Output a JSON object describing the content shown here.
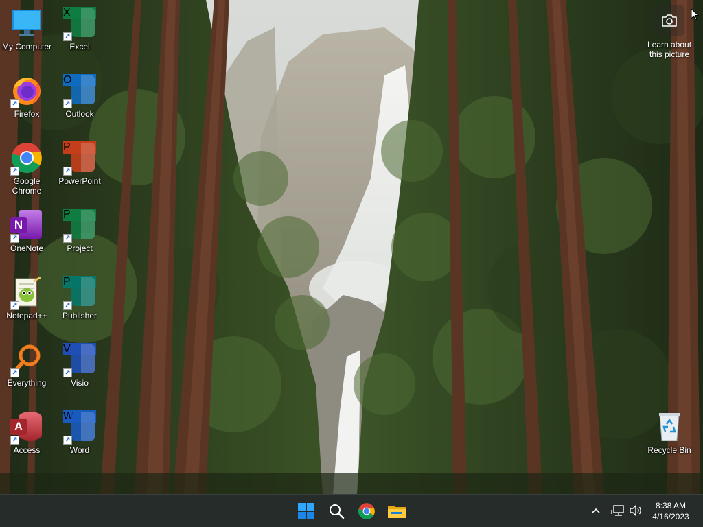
{
  "desktop": {
    "column1": [
      {
        "label": "My Computer",
        "icon": "monitor-icon"
      },
      {
        "label": "Firefox",
        "icon": "firefox-icon"
      },
      {
        "label": "Google\nChrome",
        "icon": "chrome-icon"
      },
      {
        "label": "OneNote",
        "icon": "onenote-icon"
      },
      {
        "label": "Notepad++",
        "icon": "notepad-plus-plus-icon"
      },
      {
        "label": "Everything",
        "icon": "everything-search-icon"
      },
      {
        "label": "Access",
        "icon": "access-icon"
      }
    ],
    "column2": [
      {
        "label": "Excel",
        "icon": "excel-icon",
        "letter": "X",
        "color": "#107c41"
      },
      {
        "label": "Outlook",
        "icon": "outlook-icon",
        "letter": "O",
        "color": "#0f6cbd"
      },
      {
        "label": "PowerPoint",
        "icon": "powerpoint-icon",
        "letter": "P",
        "color": "#c43e1c"
      },
      {
        "label": "Project",
        "icon": "project-icon",
        "letter": "P",
        "color": "#107c41"
      },
      {
        "label": "Publisher",
        "icon": "publisher-icon",
        "letter": "P",
        "color": "#077568"
      },
      {
        "label": "Visio",
        "icon": "visio-icon",
        "letter": "V",
        "color": "#1f4fb5"
      },
      {
        "label": "Word",
        "icon": "word-icon",
        "letter": "W",
        "color": "#185abd"
      }
    ],
    "access_letter": "A",
    "onenote_letter": "N",
    "recycle_bin": {
      "label": "Recycle Bin",
      "icon": "recycle-bin-icon"
    },
    "learn_about": {
      "label": "Learn about\nthis picture",
      "icon": "camera-icon"
    }
  },
  "taskbar": {
    "pinned": [
      {
        "name": "start-button",
        "icon": "windows-logo-icon"
      },
      {
        "name": "search-button",
        "icon": "search-icon"
      },
      {
        "name": "chrome-taskbar-button",
        "icon": "chrome-icon"
      },
      {
        "name": "file-explorer-button",
        "icon": "folder-icon"
      }
    ],
    "tray": {
      "overflow_icon": "chevron-up-icon",
      "network_icon": "network-icon",
      "volume_icon": "speaker-icon"
    },
    "clock": {
      "time": "8:38 AM",
      "date": "4/16/2023"
    }
  },
  "colors": {
    "taskbar_bg": "#262c2a",
    "accent_blue": "#0078d4"
  }
}
